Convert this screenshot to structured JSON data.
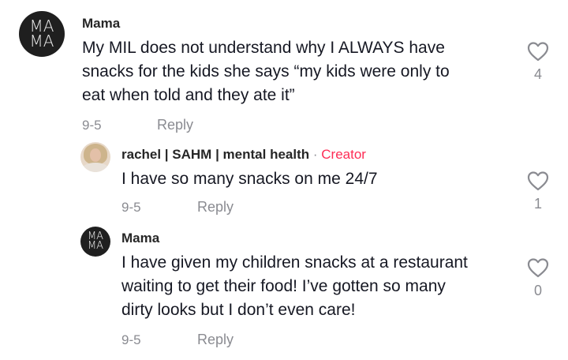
{
  "comments": [
    {
      "avatar_text": [
        "MA",
        "MA"
      ],
      "username": "Mama",
      "text_lines": [
        "My MIL does not understand why I ALWAYS have",
        "snacks for the kids she says “my kids were only to",
        "eat when told and they ate it”"
      ],
      "date": "9-5",
      "reply_label": "Reply",
      "likes": "4"
    },
    {
      "username": "rachel | SAHM | mental health",
      "separator": "·",
      "creator_label": "Creator",
      "text_lines": [
        "I have so many snacks on me 24/7"
      ],
      "date": "9-5",
      "reply_label": "Reply",
      "likes": "1"
    },
    {
      "avatar_text": [
        "MA",
        "MA"
      ],
      "username": "Mama",
      "text_lines": [
        "I have given my children snacks at a restaurant",
        "waiting to get their food! I’ve gotten so many",
        "dirty looks but I don’t even care!"
      ],
      "date": "9-5",
      "reply_label": "Reply",
      "likes": "0"
    }
  ],
  "icons": {
    "like": "heart-outline-icon"
  },
  "colors": {
    "creator": "#fe2c55",
    "meta": "#8a8b91",
    "text": "#161823"
  }
}
